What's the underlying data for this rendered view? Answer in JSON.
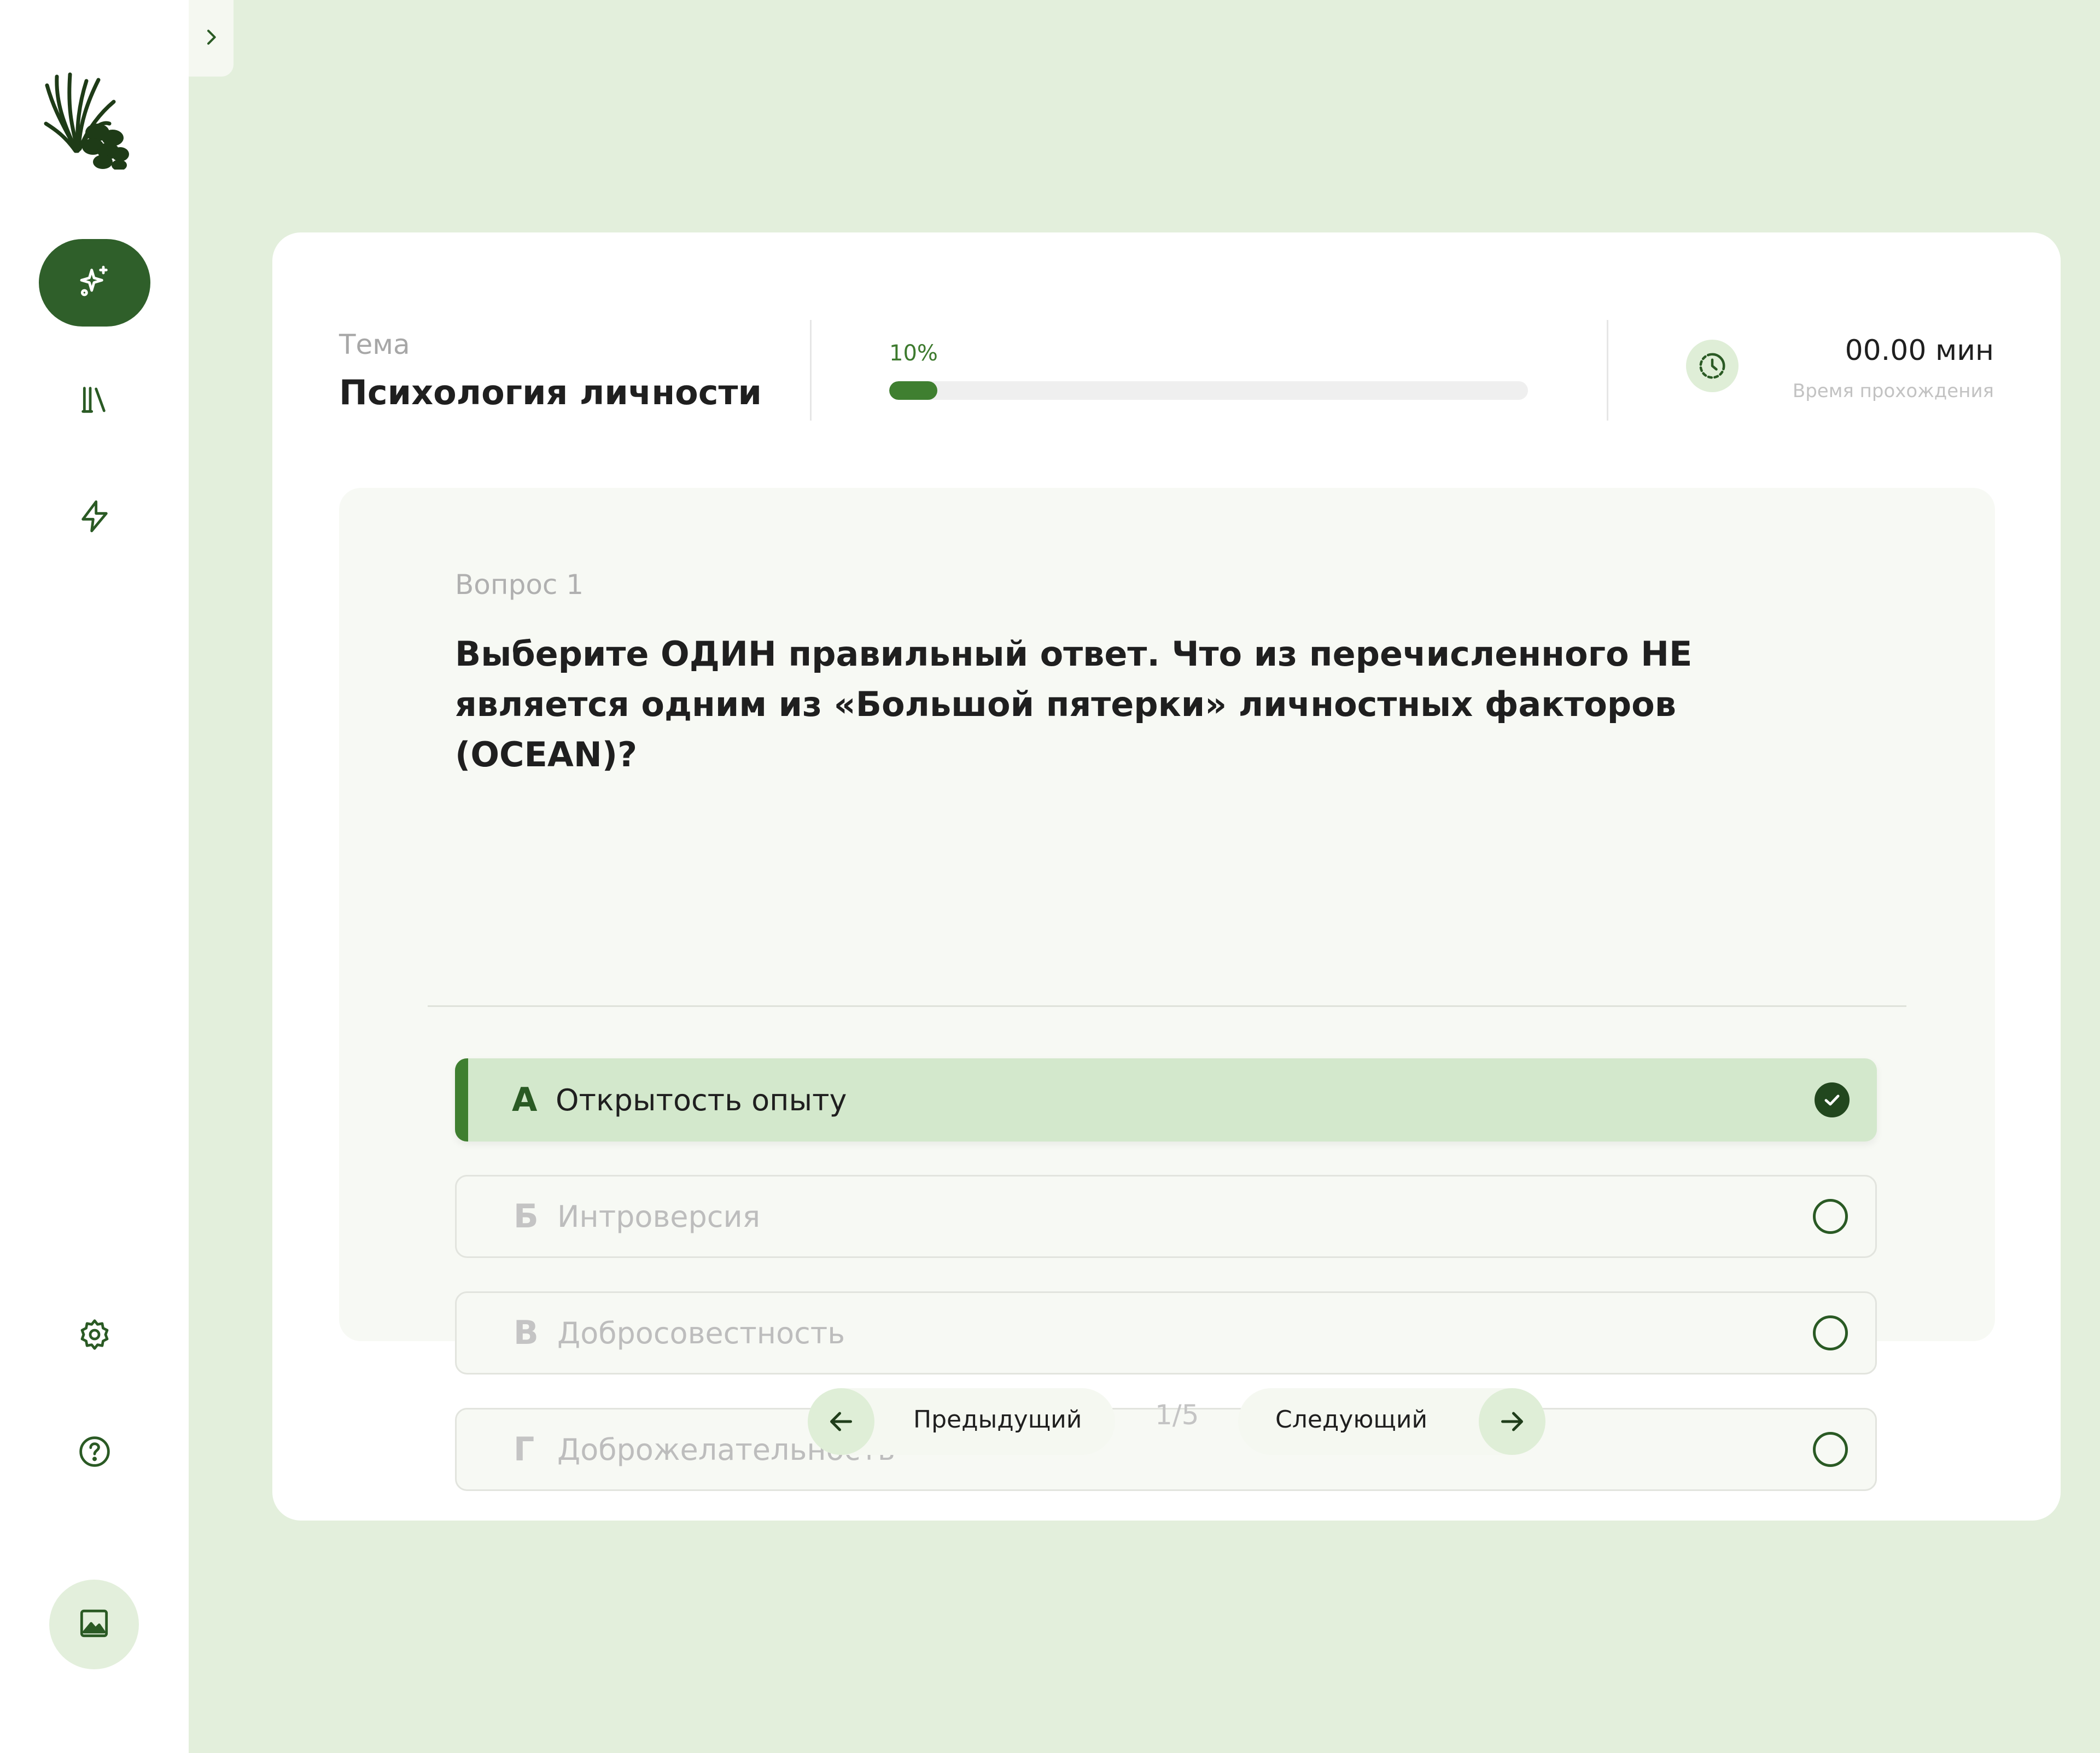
{
  "sidebar": {
    "items": [
      {
        "icon": "sparkles-icon",
        "active": true
      },
      {
        "icon": "library-icon",
        "active": false
      },
      {
        "icon": "lightning-icon",
        "active": false
      },
      {
        "icon": "gear-icon",
        "active": false
      },
      {
        "icon": "help-icon",
        "active": false
      }
    ],
    "avatar_icon": "image-icon",
    "collapse_icon": "chevron-right-icon"
  },
  "header": {
    "topic_label": "Тема",
    "topic_value": "Психология личности",
    "progress": {
      "label": "10%",
      "value": 0.075
    },
    "time_value": "00.00 мин",
    "time_label": "Время прохождения"
  },
  "question": {
    "number_label": "Вопрос 1",
    "text": "Выберите ОДИН правильный ответ. Что из перечисленного НЕ является одним из «Большой пятерки» личностных факторов (OCEAN)?",
    "options": [
      {
        "letter": "А",
        "text": "Открытость опыту",
        "selected": true
      },
      {
        "letter": "Б",
        "text": "Интроверсия",
        "selected": false
      },
      {
        "letter": "В",
        "text": "Добросовестность",
        "selected": false
      },
      {
        "letter": "Г",
        "text": "Доброжелательность",
        "selected": false
      }
    ]
  },
  "pager": {
    "prev_label": "Предыдущий",
    "next_label": "Следующий",
    "indicator": "1/5"
  },
  "colors": {
    "accent": "#2f5f2a",
    "accent_light": "#d3e8cc",
    "background": "#e3efdc"
  }
}
